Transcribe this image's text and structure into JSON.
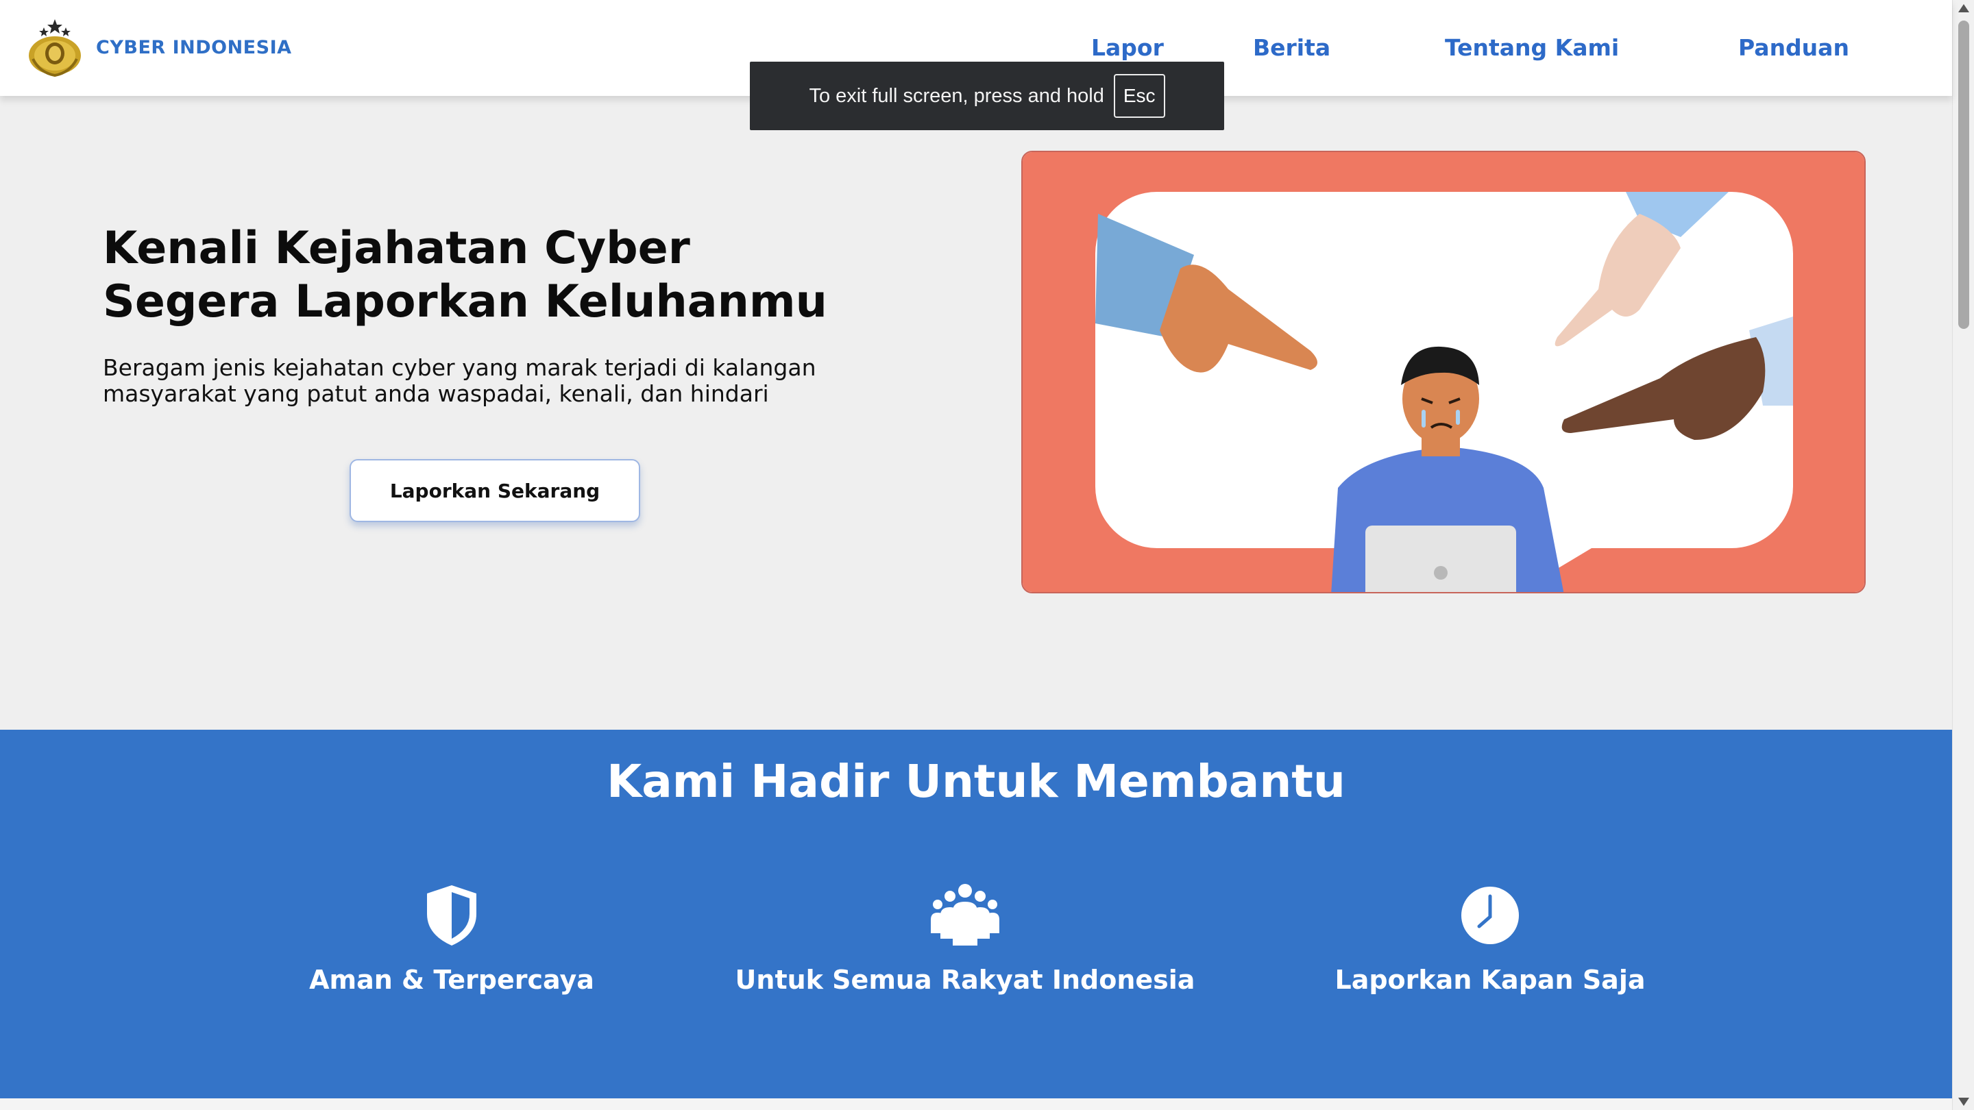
{
  "header": {
    "brand": "CYBER INDONESIA",
    "logo_icon": "police-emblem-icon",
    "nav": [
      {
        "label": "Lapor"
      },
      {
        "label": "Berita"
      },
      {
        "label": "Tentang Kami"
      },
      {
        "label": "Panduan"
      }
    ]
  },
  "fullscreen_toast": {
    "text": "To exit full screen, press and hold",
    "key": "Esc"
  },
  "hero": {
    "title_line1": "Kenali Kejahatan Cyber",
    "title_line2": "Segera Laporkan Keluhanmu",
    "subtitle": "Beragam jenis kejahatan cyber yang marak terjadi di kalangan masyarakat yang patut anda waspadai, kenali, dan hindari",
    "cta_label": "Laporkan Sekarang",
    "illustration_icon": "blamed-person-illustration"
  },
  "features_section": {
    "title": "Kami Hadir Untuk Membantu",
    "items": [
      {
        "label": "Aman & Terpercaya",
        "icon": "shield-icon"
      },
      {
        "label": "Untuk Semua Rakyat Indonesia",
        "icon": "people-group-icon"
      },
      {
        "label": "Laporkan Kapan Saja",
        "icon": "clock-icon"
      }
    ]
  },
  "colors": {
    "brand_blue": "#3474c8",
    "nav_blue": "#2d6ac8",
    "illustration_bg": "#ef7862",
    "page_bg": "#efefef"
  }
}
